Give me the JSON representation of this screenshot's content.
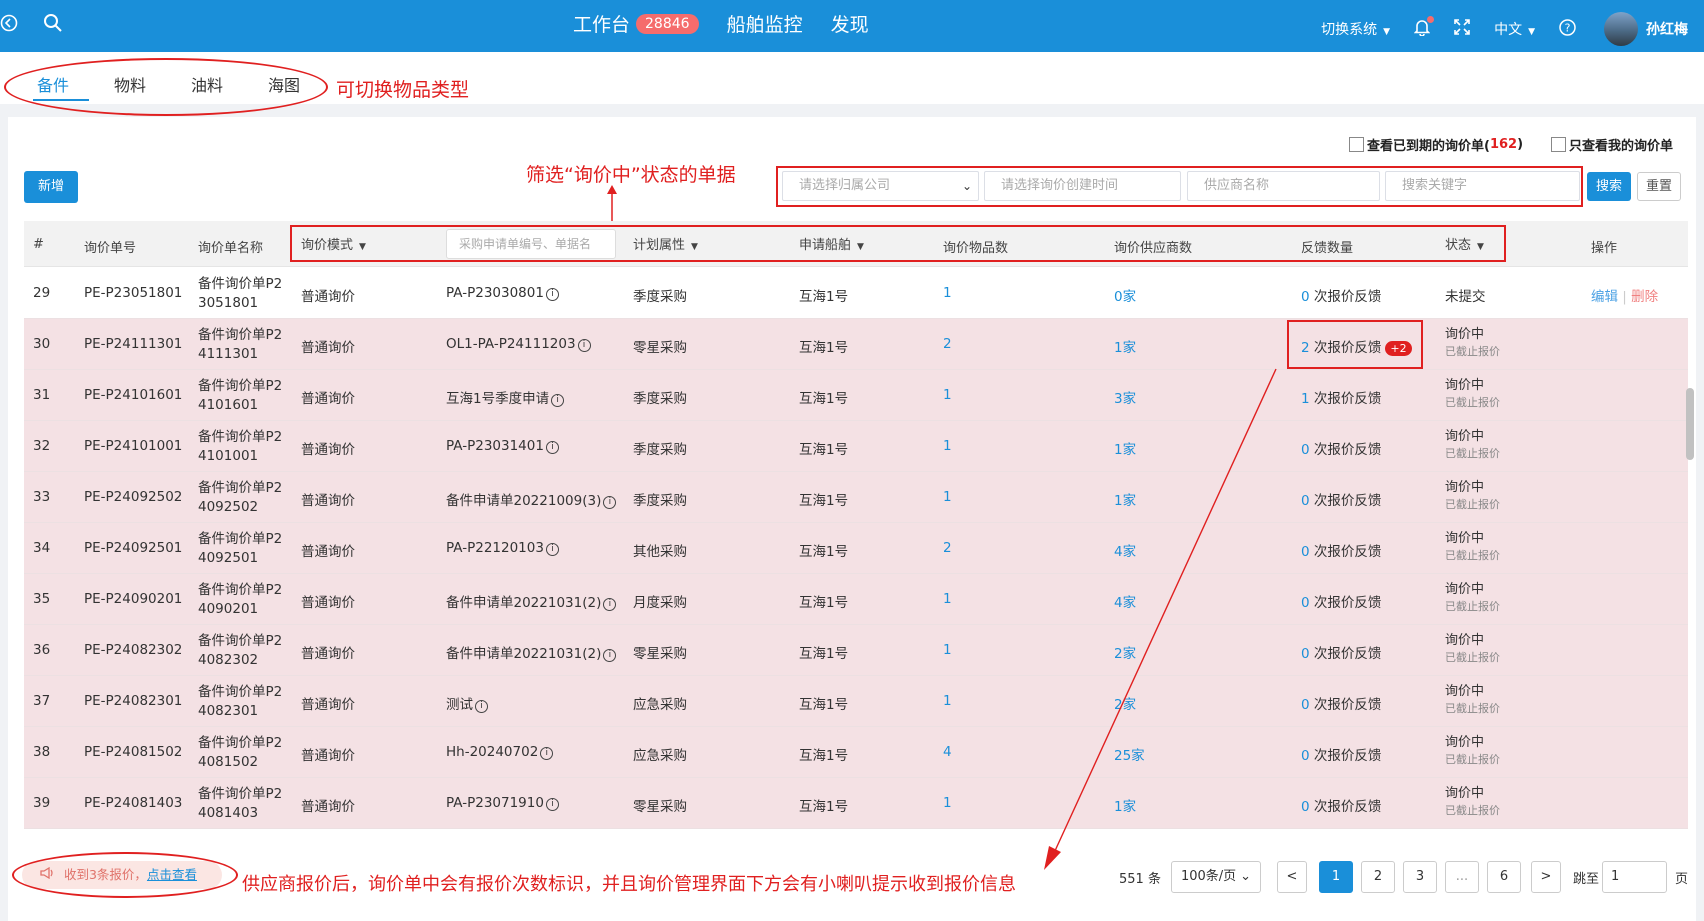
{
  "topbar": {
    "nav": [
      {
        "label": "工作台",
        "badge": "28846"
      },
      {
        "label": "船舶监控"
      },
      {
        "label": "发现"
      }
    ],
    "switch_system": "切换系统",
    "language": "中文",
    "user_name": "孙红梅"
  },
  "tabs": [
    "备件",
    "物料",
    "油料",
    "海图"
  ],
  "annotations": {
    "tabs_note": "可切换物品类型",
    "filter_note": "筛选“询价中”状态的单据",
    "notify_note": "供应商报价后，询价单中会有报价次数标识，并且询价管理界面下方会有小喇叭提示收到报价信息"
  },
  "checkboxes": {
    "expired_label": "查看已到期的询价单(",
    "expired_count": "162",
    "expired_close": ")",
    "mine_label": "只查看我的询价单"
  },
  "toolbar": {
    "add_label": "新增",
    "company_placeholder": "请选择归属公司",
    "time_placeholder": "请选择询价创建时间",
    "supplier_placeholder": "供应商名称",
    "keyword_placeholder": "搜索关键字",
    "search_label": "搜索",
    "reset_label": "重置"
  },
  "table": {
    "headers": {
      "idx": "#",
      "no": "询价单号",
      "name": "询价单名称",
      "mode": "询价模式",
      "apply_placeholder": "采购申请单编号、单据名",
      "plan": "计划属性",
      "vessel": "申请船舶",
      "items": "询价物品数",
      "suppliers": "询价供应商数",
      "feedback": "反馈数量",
      "status": "状态",
      "ops": "操作"
    },
    "rows": [
      {
        "idx": "29",
        "no": "PE-P23051801",
        "name1": "备件询价单P2",
        "name2": "3051801",
        "mode": "普通询价",
        "apply": "PA-P23030801",
        "plan": "季度采购",
        "vessel": "互海1号",
        "items": "1",
        "suppliers": "0家",
        "fb_num": "0",
        "fb_text": "次报价反馈",
        "plus": "",
        "status1": "未提交",
        "status2": "",
        "edit": "编辑",
        "sep": "|",
        "del": "删除"
      },
      {
        "idx": "30",
        "no": "PE-P24111301",
        "name1": "备件询价单P2",
        "name2": "4111301",
        "mode": "普通询价",
        "apply": "OL1-PA-P24111203",
        "plan": "零星采购",
        "vessel": "互海1号",
        "items": "2",
        "suppliers": "1家",
        "fb_num": "2",
        "fb_text": "次报价反馈",
        "plus": "+2",
        "status1": "询价中",
        "status2": "已截止报价",
        "edit": "",
        "sep": "",
        "del": ""
      },
      {
        "idx": "31",
        "no": "PE-P24101601",
        "name1": "备件询价单P2",
        "name2": "4101601",
        "mode": "普通询价",
        "apply": "互海1号季度申请",
        "plan": "季度采购",
        "vessel": "互海1号",
        "items": "1",
        "suppliers": "3家",
        "fb_num": "1",
        "fb_text": "次报价反馈",
        "plus": "",
        "status1": "询价中",
        "status2": "已截止报价",
        "edit": "",
        "sep": "",
        "del": ""
      },
      {
        "idx": "32",
        "no": "PE-P24101001",
        "name1": "备件询价单P2",
        "name2": "4101001",
        "mode": "普通询价",
        "apply": "PA-P23031401",
        "plan": "季度采购",
        "vessel": "互海1号",
        "items": "1",
        "suppliers": "1家",
        "fb_num": "0",
        "fb_text": "次报价反馈",
        "plus": "",
        "status1": "询价中",
        "status2": "已截止报价",
        "edit": "",
        "sep": "",
        "del": ""
      },
      {
        "idx": "33",
        "no": "PE-P24092502",
        "name1": "备件询价单P2",
        "name2": "4092502",
        "mode": "普通询价",
        "apply": "备件申请单20221009(3)",
        "plan": "季度采购",
        "vessel": "互海1号",
        "items": "1",
        "suppliers": "1家",
        "fb_num": "0",
        "fb_text": "次报价反馈",
        "plus": "",
        "status1": "询价中",
        "status2": "已截止报价",
        "edit": "",
        "sep": "",
        "del": ""
      },
      {
        "idx": "34",
        "no": "PE-P24092501",
        "name1": "备件询价单P2",
        "name2": "4092501",
        "mode": "普通询价",
        "apply": "PA-P22120103",
        "plan": "其他采购",
        "vessel": "互海1号",
        "items": "2",
        "suppliers": "4家",
        "fb_num": "0",
        "fb_text": "次报价反馈",
        "plus": "",
        "status1": "询价中",
        "status2": "已截止报价",
        "edit": "",
        "sep": "",
        "del": ""
      },
      {
        "idx": "35",
        "no": "PE-P24090201",
        "name1": "备件询价单P2",
        "name2": "4090201",
        "mode": "普通询价",
        "apply": "备件申请单20221031(2)",
        "plan": "月度采购",
        "vessel": "互海1号",
        "items": "1",
        "suppliers": "4家",
        "fb_num": "0",
        "fb_text": "次报价反馈",
        "plus": "",
        "status1": "询价中",
        "status2": "已截止报价",
        "edit": "",
        "sep": "",
        "del": ""
      },
      {
        "idx": "36",
        "no": "PE-P24082302",
        "name1": "备件询价单P2",
        "name2": "4082302",
        "mode": "普通询价",
        "apply": "备件申请单20221031(2)",
        "plan": "零星采购",
        "vessel": "互海1号",
        "items": "1",
        "suppliers": "2家",
        "fb_num": "0",
        "fb_text": "次报价反馈",
        "plus": "",
        "status1": "询价中",
        "status2": "已截止报价",
        "edit": "",
        "sep": "",
        "del": ""
      },
      {
        "idx": "37",
        "no": "PE-P24082301",
        "name1": "备件询价单P2",
        "name2": "4082301",
        "mode": "普通询价",
        "apply": "测试",
        "plan": "应急采购",
        "vessel": "互海1号",
        "items": "1",
        "suppliers": "2家",
        "fb_num": "0",
        "fb_text": "次报价反馈",
        "plus": "",
        "status1": "询价中",
        "status2": "已截止报价",
        "edit": "",
        "sep": "",
        "del": ""
      },
      {
        "idx": "38",
        "no": "PE-P24081502",
        "name1": "备件询价单P2",
        "name2": "4081502",
        "mode": "普通询价",
        "apply": "Hh-20240702",
        "plan": "应急采购",
        "vessel": "互海1号",
        "items": "4",
        "suppliers": "25家",
        "fb_num": "0",
        "fb_text": "次报价反馈",
        "plus": "",
        "status1": "询价中",
        "status2": "已截止报价",
        "edit": "",
        "sep": "",
        "del": ""
      },
      {
        "idx": "39",
        "no": "PE-P24081403",
        "name1": "备件询价单P2",
        "name2": "4081403",
        "mode": "普通询价",
        "apply": "PA-P23071910",
        "plan": "零星采购",
        "vessel": "互海1号",
        "items": "1",
        "suppliers": "1家",
        "fb_num": "0",
        "fb_text": "次报价反馈",
        "plus": "",
        "status1": "询价中",
        "status2": "已截止报价",
        "edit": "",
        "sep": "",
        "del": ""
      }
    ]
  },
  "notify": {
    "text": "收到3条报价，",
    "link": "点击查看"
  },
  "pagination": {
    "total": "551 条",
    "page_size": "100条/页",
    "prev": "<",
    "pages": [
      "1",
      "2",
      "3",
      "...",
      "6"
    ],
    "current": "1",
    "next": ">",
    "jump_label": "跳至",
    "jump_value": "1",
    "page_suffix": "页"
  },
  "colors": {
    "primary": "#1a8fd9",
    "annotation": "#e02020",
    "row_highlight": "#f4e1e4"
  }
}
